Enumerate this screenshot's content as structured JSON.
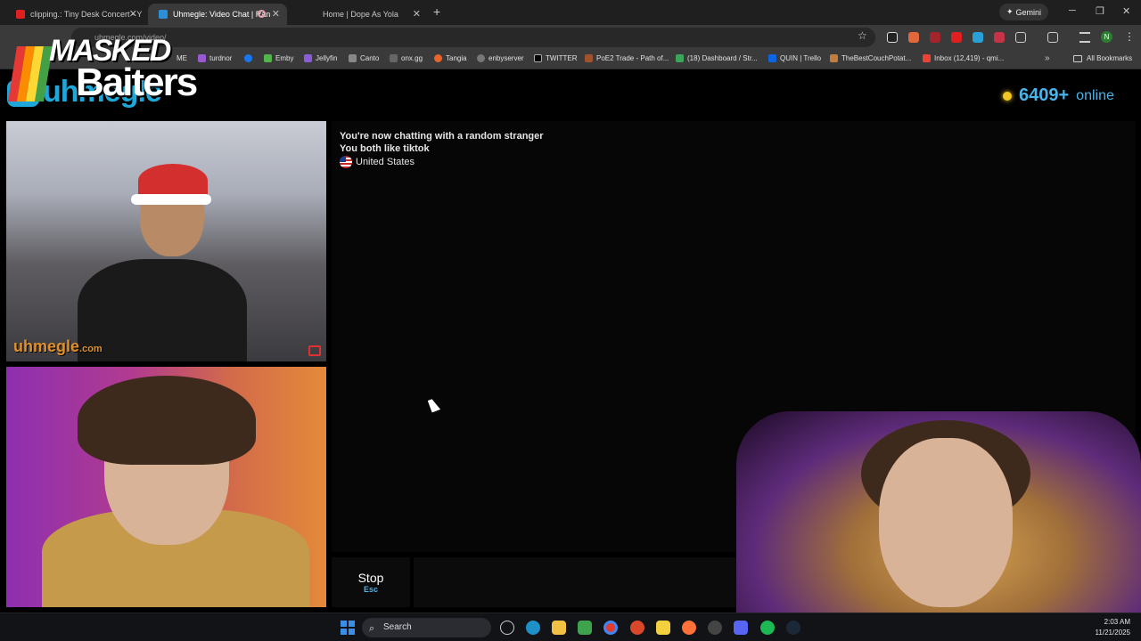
{
  "browser": {
    "tabs": [
      {
        "label": "clipping.: Tiny Desk Concert - Y",
        "active": false
      },
      {
        "label": "Uhmegle: Video Chat | Ran",
        "active": true
      },
      {
        "label": "Home | Dope As Yola",
        "active": false
      }
    ],
    "gemini_label": "Gemini",
    "address": "uhmegle.com/video/",
    "profile_initial": "N",
    "bookmarks": [
      "ME",
      "turdnor",
      "Emby",
      "Jellyfin",
      "Canto",
      "onx.gg",
      "Tangia",
      "enbyserver",
      "TWITTER",
      "PoE2 Trade - Path of...",
      "(18) Dashboard / Str...",
      "QUIN | Trello",
      "TheBestCouchPotat...",
      "Inbox (12,419) - qmi..."
    ],
    "all_bookmarks": "All Bookmarks"
  },
  "overlay": {
    "line1": "MASKED",
    "line2": "Baiters"
  },
  "site": {
    "logo_text": "uhmegle",
    "online_count": "6409+",
    "online_label": "online",
    "watermark": "uhmegle",
    "watermark_suffix": ".com"
  },
  "chat": {
    "line1": "You're now chatting with a random stranger",
    "line2": "You both like tiktok",
    "country": "United States"
  },
  "controls": {
    "stop_label": "Stop",
    "stop_key": "Esc"
  },
  "taskbar": {
    "search_label": "Search",
    "time": "2:03 AM",
    "date": "11/21/2025"
  }
}
